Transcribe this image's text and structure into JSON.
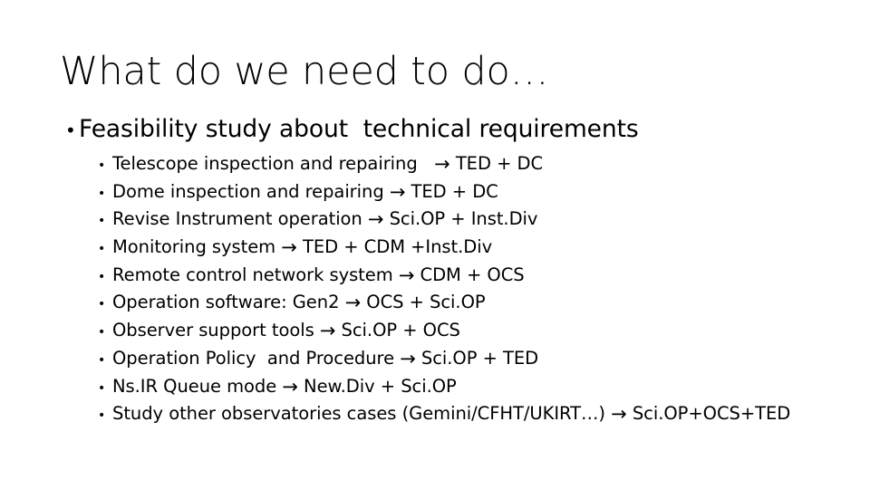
{
  "slide": {
    "title": "What do we need to do…",
    "background_color": "#ffffff",
    "text_color": "#000000",
    "bullet_glyph_level1": "•",
    "bullet_glyph_level2": "•",
    "arrow_glyph": "→"
  },
  "level1": {
    "text": "Feasibility study about  technical requirements"
  },
  "level2": {
    "items": [
      {
        "task": "Telescope inspection and repairing   ",
        "owners": " TED + DC",
        "full": "Telescope inspection and repairing   → TED + DC"
      },
      {
        "task": "Dome inspection and repairing ",
        "owners": " TED + DC",
        "full": "Dome inspection and repairing → TED + DC"
      },
      {
        "task": "Revise Instrument operation ",
        "owners": " Sci.OP + Inst.Div",
        "full": "Revise Instrument operation → Sci.OP + Inst.Div"
      },
      {
        "task": "Monitoring system ",
        "owners": " TED + CDM +Inst.Div",
        "full": "Monitoring system → TED + CDM +Inst.Div"
      },
      {
        "task": "Remote control network system ",
        "owners": " CDM + OCS",
        "full": "Remote control network system → CDM + OCS"
      },
      {
        "task": "Operation software: Gen2 ",
        "owners": " OCS + Sci.OP",
        "full": "Operation software: Gen2 → OCS + Sci.OP"
      },
      {
        "task": "Observer support tools ",
        "owners": " Sci.OP + OCS",
        "full": "Observer support tools → Sci.OP + OCS"
      },
      {
        "task": "Operation Policy  and Procedure ",
        "owners": " Sci.OP + TED",
        "full": "Operation Policy  and Procedure → Sci.OP + TED"
      },
      {
        "task": "Ns.IR Queue mode ",
        "owners": " New.Div + Sci.OP",
        "full": "Ns.IR Queue mode → New.Div + Sci.OP"
      },
      {
        "task": "Study other observatories cases (Gemini/CFHT/UKIRT…) ",
        "owners": " Sci.OP+OCS+TED",
        "full": "Study other observatories cases (Gemini/CFHT/UKIRT…) → Sci.OP+OCS+TED"
      }
    ]
  }
}
